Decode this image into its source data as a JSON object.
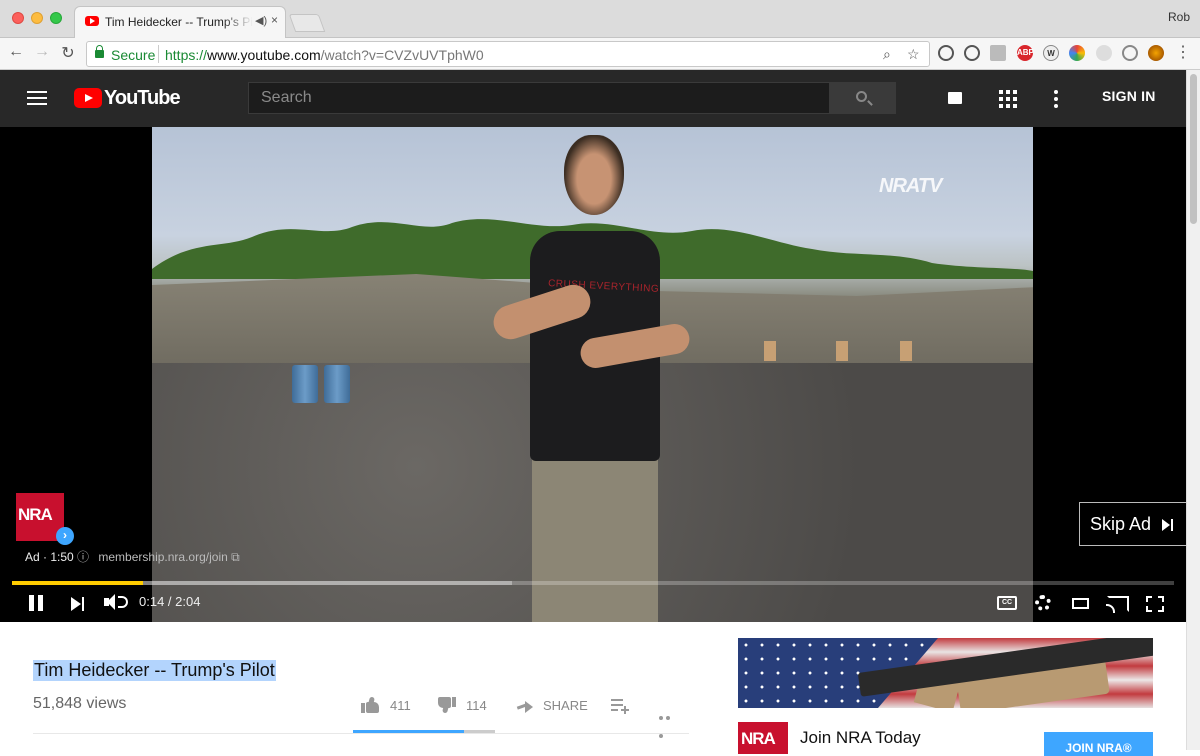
{
  "browser": {
    "tab_title": "Tim Heidecker -- Trump's Pilot",
    "tab_close": "×",
    "profile_name": "Rob",
    "security_label": "Secure",
    "url_scheme": "https://",
    "url_host": "www.youtube.com",
    "url_path": "/watch?v=CVZvUVTphW0",
    "extensions": [
      "history-icon",
      "info-icon",
      "pocket-icon",
      "adblock-icon",
      "wikipedia-icon",
      "color-picker-icon",
      "ghost-icon",
      "link-icon",
      "face-icon",
      "menu-icon"
    ],
    "ext_abp_label": "ABP",
    "ext_w_label": "W"
  },
  "youtube": {
    "logo_text": "YouTube",
    "search_placeholder": "Search",
    "sign_in_label": "SIGN IN"
  },
  "player": {
    "watermark": "NRATV",
    "shirt_text": "CRUSH EVERYTHING",
    "ad_logo_text": "NRA",
    "ad_label": "Ad · 1:50",
    "ad_link": "membership.nra.org/join",
    "skip_label": "Skip Ad",
    "current_time": "0:14",
    "duration": "2:04",
    "time_display": "0:14 / 2:04",
    "progress_fraction": 0.113,
    "buffered_fraction": 0.43,
    "cc_label": "CC"
  },
  "video": {
    "title": "Tim Heidecker -- Trump's Pilot",
    "views": "51,848 views",
    "likes": "411",
    "dislikes": "114",
    "share_label": "SHARE",
    "like_fraction": 0.783
  },
  "sidebar_ad": {
    "logo_text": "NRA",
    "title": "Join NRA Today",
    "button_label": "JOIN NRA®"
  },
  "colors": {
    "accent": "#3ea6ff",
    "brand_red": "#ff0000",
    "ad_progress": "#ffcc00",
    "header_bg": "#282828"
  }
}
